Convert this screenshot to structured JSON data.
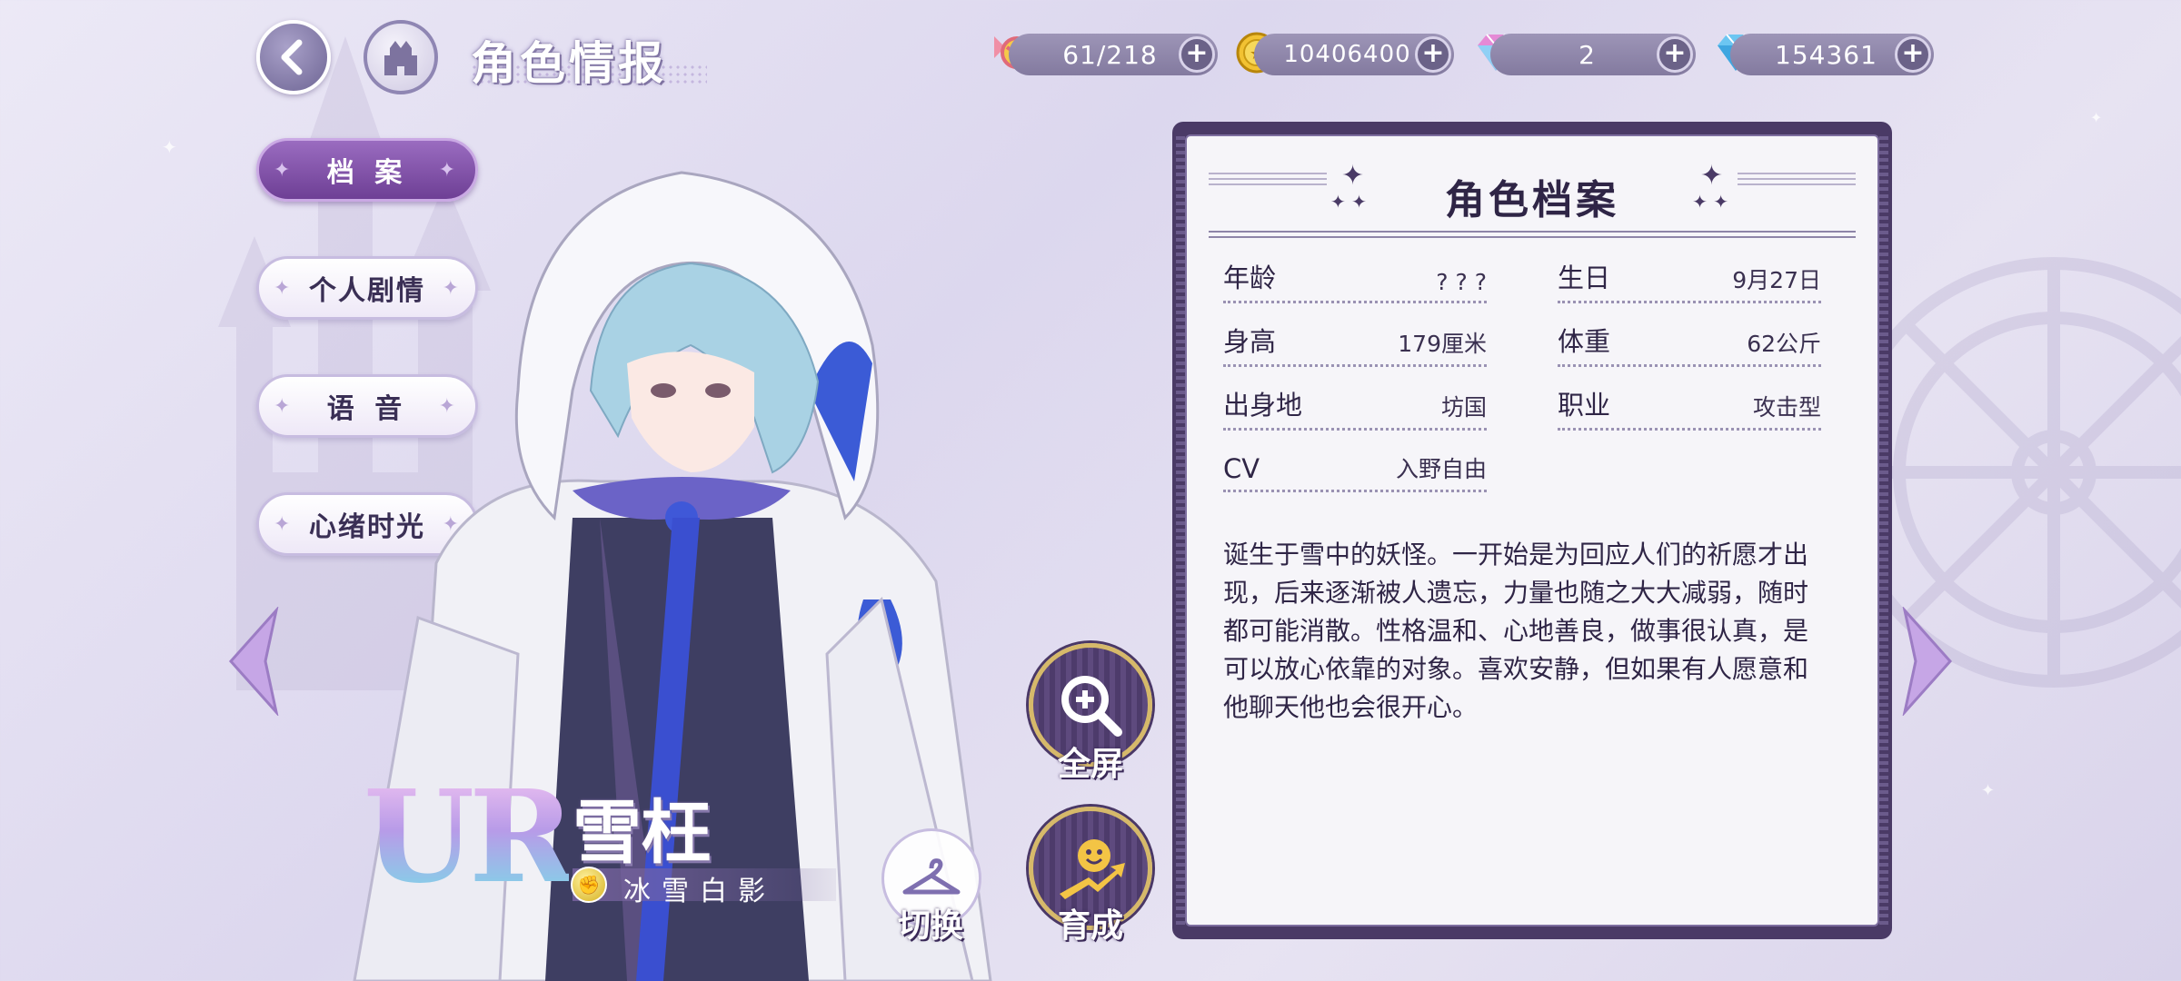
{
  "header": {
    "title": "角色情报",
    "back_icon": "back-arrow-icon",
    "home_icon": "castle-home-icon"
  },
  "resources": [
    {
      "name": "candy",
      "icon": "candy-icon",
      "value": "61/218"
    },
    {
      "name": "gold",
      "icon": "coin-icon",
      "value": "10406400"
    },
    {
      "name": "rainbow-gem",
      "icon": "rainbow-diamond-icon",
      "value": "2"
    },
    {
      "name": "diamond",
      "icon": "blue-diamond-icon",
      "value": "154361"
    }
  ],
  "tabs": [
    {
      "label": "档 案",
      "active": true
    },
    {
      "label": "个人剧情",
      "active": false
    },
    {
      "label": "语 音",
      "active": false
    },
    {
      "label": "心绪时光",
      "active": false
    }
  ],
  "character": {
    "rarity": "UR",
    "name": "雪枉",
    "subtitle": "冰雪白影",
    "element_icon": "fist-badge-icon"
  },
  "actions": {
    "fullscreen_label": "全屏",
    "develop_label": "育成",
    "switch_label": "切换"
  },
  "profile": {
    "title": "角色档案",
    "rows": [
      {
        "label": "年龄",
        "value": "? ? ?"
      },
      {
        "label": "生日",
        "value": "9月27日"
      },
      {
        "label": "身高",
        "value": "179厘米"
      },
      {
        "label": "体重",
        "value": "62公斤"
      },
      {
        "label": "出身地",
        "value": "坊国"
      },
      {
        "label": "职业",
        "value": "攻击型"
      },
      {
        "label": "CV",
        "value": "入野自由"
      }
    ],
    "description": "诞生于雪中的妖怪。一开始是为回应人们的祈愿才出现，后来逐渐被人遗忘，力量也随之大大减弱，随时都可能消散。性格温和、心地善良，做事很认真，是可以放心依靠的对象。喜欢安静，但如果有人愿意和他聊天他也会很开心。"
  },
  "colors": {
    "accent_purple": "#6e3f95",
    "panel_border": "#4a3a66",
    "gold_ring": "#d6b96a"
  }
}
